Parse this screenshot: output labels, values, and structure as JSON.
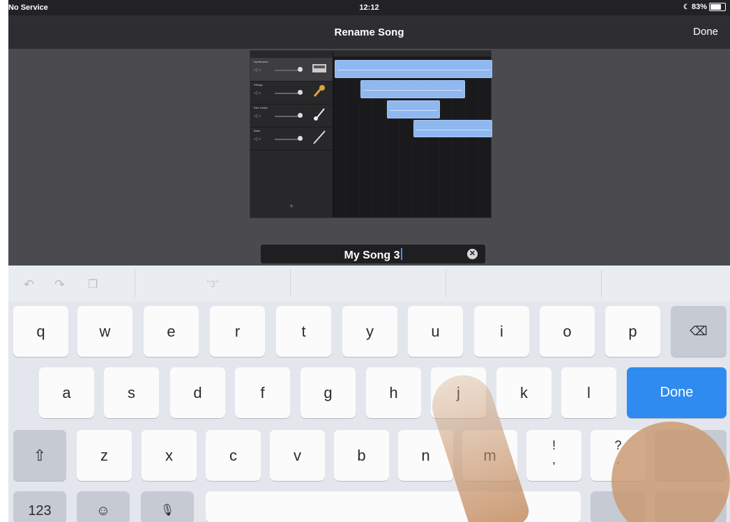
{
  "status_bar": {
    "carrier": "No Service",
    "time": "12:12",
    "battery": "83%",
    "battery_level": 0.83
  },
  "nav": {
    "title": "Rename Song",
    "done_label": "Done"
  },
  "preview": {
    "tracks": [
      {
        "name": "Synthesizer"
      },
      {
        "name": "Strings"
      },
      {
        "name": "Elec Guitar"
      },
      {
        "name": "Bass"
      }
    ],
    "add_label": "+"
  },
  "name_field": {
    "value": "My Song 3",
    "clear_icon": "x-circle-icon"
  },
  "keyboard": {
    "suggestion": "\"3\"",
    "row1": [
      "q",
      "w",
      "e",
      "r",
      "t",
      "y",
      "u",
      "i",
      "o",
      "p"
    ],
    "row2": [
      "a",
      "s",
      "d",
      "f",
      "g",
      "h",
      "j",
      "k",
      "l"
    ],
    "row3": [
      "z",
      "x",
      "c",
      "v",
      "b",
      "n",
      "m"
    ],
    "punct1_top": "!",
    "punct1_bottom": ",",
    "punct2_top": "?",
    "punct2_bottom": ".",
    "done_label": "Done",
    "numbers_label": "123",
    "colors": {
      "done_key": "#2f8bf0"
    }
  }
}
